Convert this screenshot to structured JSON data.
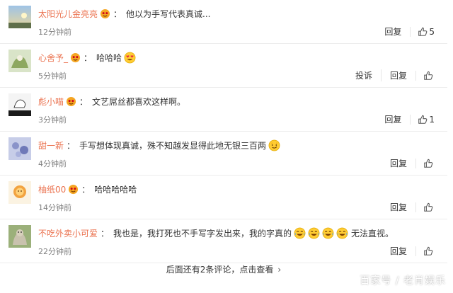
{
  "comments": [
    {
      "user": "太阳光儿金亮亮",
      "text": "他以为手写代表真诚...",
      "time": "12分钟前",
      "reply": "回复",
      "likes": "5",
      "emojis": []
    },
    {
      "user": "心舍予_",
      "text": "哈哈哈",
      "time": "5分钟前",
      "report": "投诉",
      "reply": "回复",
      "likes": "",
      "emojis": [
        "heart-eyes-emoji"
      ]
    },
    {
      "user": "彪小喵",
      "text": "文艺屌丝都喜欢这样啊。",
      "time": "3分钟前",
      "reply": "回复",
      "likes": "1",
      "emojis": []
    },
    {
      "user": "甜一新",
      "text": "手写想体现真诚，殊不知越发显得此地无银三百两",
      "time": "4分钟前",
      "reply": "回复",
      "likes": "",
      "emojis": [
        "smirk-emoji"
      ]
    },
    {
      "user": "柚纸00",
      "text": "哈哈哈哈哈",
      "time": "14分钟前",
      "reply": "回复",
      "likes": "",
      "emojis": []
    },
    {
      "user": "不吃外卖小可爱",
      "text": "我也是，我打死也不手写字发出来，我的字真的",
      "text2": "无法直视。",
      "time": "22分钟前",
      "reply": "回复",
      "likes": "",
      "emojis": [
        "laugh-cry-emoji",
        "laugh-cry-emoji",
        "laugh-cry-emoji",
        "laugh-cry-emoji"
      ]
    }
  ],
  "separator": "：",
  "more_text": "后面还有2条评论，点击查看",
  "more_chevron": "›",
  "watermark": "百家号 / 老肖娱乐",
  "colors": {
    "username": "#eb7350",
    "time": "#808080",
    "text": "#333333"
  }
}
